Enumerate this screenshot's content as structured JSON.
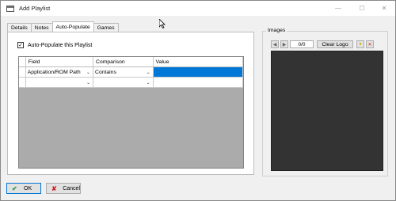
{
  "window": {
    "title": "Add Playlist"
  },
  "tabs": [
    {
      "label": "Details",
      "active": false
    },
    {
      "label": "Notes",
      "active": false
    },
    {
      "label": "Auto-Populate",
      "active": true
    },
    {
      "label": "Games",
      "active": false
    }
  ],
  "auto_populate": {
    "checkbox_label": "Auto-Populate this Playlist",
    "checked": true,
    "columns": [
      "Field",
      "Comparison",
      "Value"
    ],
    "rows": [
      {
        "field": "Application/ROM Path",
        "comparison": "Contains",
        "value": "",
        "selected_value": true
      },
      {
        "field": "",
        "comparison": "",
        "value": ""
      }
    ]
  },
  "images": {
    "group_label": "Images",
    "counter": "0/0",
    "clear_label": "Clear Logo"
  },
  "buttons": {
    "ok": "OK",
    "cancel": "Cancel"
  },
  "colors": {
    "accent": "#0078d7",
    "image_bg": "#333333",
    "grid_empty": "#ababab"
  }
}
